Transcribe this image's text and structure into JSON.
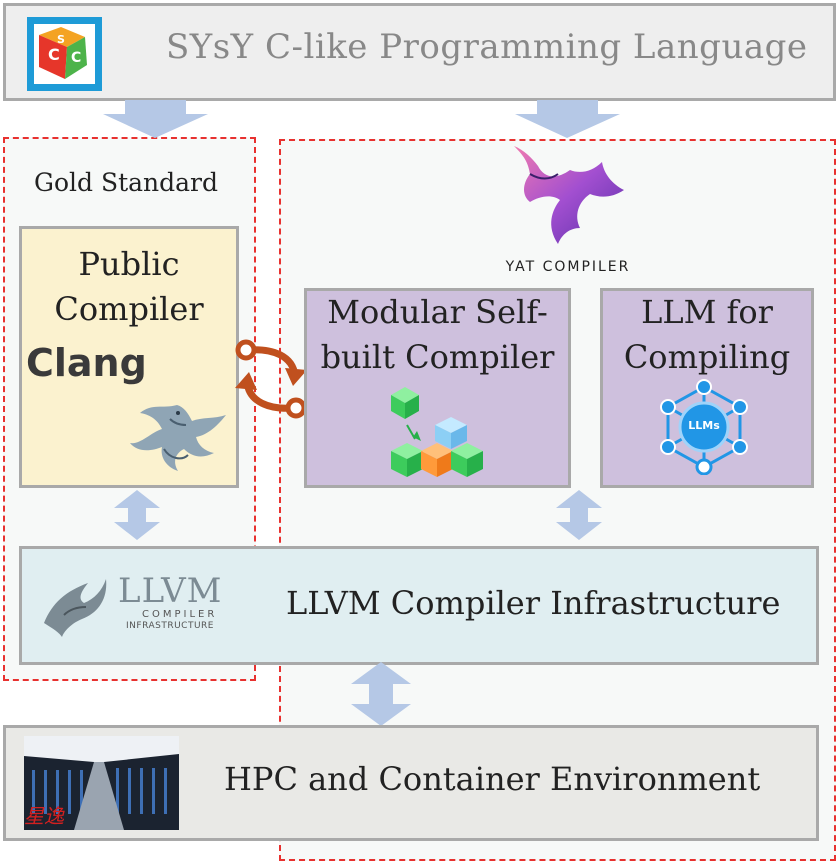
{
  "header": {
    "title": "SYsY C-like Programming Language"
  },
  "gold": {
    "label": "Gold Standard",
    "compiler_line1": "Public",
    "compiler_line2": "Compiler",
    "clang": "Clang"
  },
  "yat": {
    "logo_text": "YAT COMPILER"
  },
  "modular": {
    "line1": "Modular Self-",
    "line2": "built Compiler"
  },
  "llm": {
    "line1": "LLM for",
    "line2": "Compiling",
    "badge": "LLMs"
  },
  "llvm": {
    "title": "LLVM Compiler Infrastructure",
    "logo_main": "LLVM",
    "logo_sub1": "COMPILER",
    "logo_sub2": "INFRASTRUCTURE"
  },
  "hpc": {
    "title": "HPC and Container Environment",
    "stamp": "星逸"
  },
  "colors": {
    "dashed": "#e8312f",
    "arrow": "#b5c8e6",
    "gold_fill": "#fbf2cf",
    "purple_fill": "#cec0dd",
    "llvm_fill": "#e0eef1",
    "hpc_fill": "#e9e9e6",
    "header_fill": "#eeeeee",
    "swap_icon": "#c0501e",
    "llm_icon": "#2196e6"
  }
}
